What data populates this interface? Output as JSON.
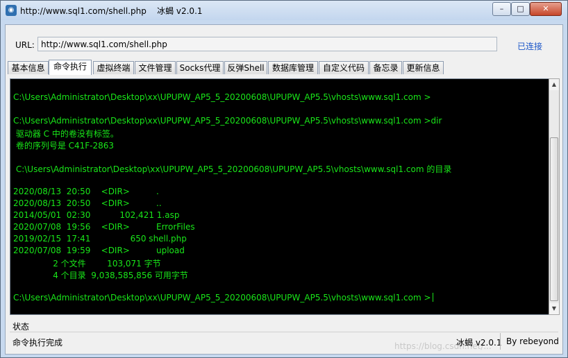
{
  "window": {
    "title": "http://www.sql1.com/shell.php    冰蝎 v2.0.1",
    "buttons": {
      "minimize": "–",
      "maximize": "□",
      "close": "✕"
    }
  },
  "url_bar": {
    "label": "URL:",
    "value": "http://www.sql1.com/shell.php",
    "status": "已连接"
  },
  "tabs": [
    {
      "label": "基本信息"
    },
    {
      "label": "命令执行",
      "active": true
    },
    {
      "label": "虚拟终端"
    },
    {
      "label": "文件管理"
    },
    {
      "label": "Socks代理"
    },
    {
      "label": "反弹Shell"
    },
    {
      "label": "数据库管理"
    },
    {
      "label": "自定义代码"
    },
    {
      "label": "备忘录"
    },
    {
      "label": "更新信息"
    }
  ],
  "console": {
    "lines": [
      "C:\\Users\\Administrator\\Desktop\\xx\\UPUPW_AP5_5_20200608\\UPUPW_AP5.5\\vhosts\\www.sql1.com >",
      "C:\\Users\\Administrator\\Desktop\\xx\\UPUPW_AP5_5_20200608\\UPUPW_AP5.5\\vhosts\\www.sql1.com >dir",
      " 驱动器 C 中的卷没有标签。",
      " 卷的序列号是 C41F-2863",
      " C:\\Users\\Administrator\\Desktop\\xx\\UPUPW_AP5_5_20200608\\UPUPW_AP5.5\\vhosts\\www.sql1.com 的目录",
      "2020/08/13  20:50    <DIR>          .",
      "2020/08/13  20:50    <DIR>          ..",
      "2014/05/01  02:30           102,421 1.asp",
      "2020/07/08  19:56    <DIR>          ErrorFiles",
      "2019/02/15  17:41               650 shell.php",
      "2020/07/08  19:59    <DIR>          upload",
      "               2 个文件        103,071 字节",
      "               4 个目录  9,038,585,856 可用字节",
      "C:\\Users\\Administrator\\Desktop\\xx\\UPUPW_AP5_5_20200608\\UPUPW_AP5.5\\vhosts\\www.sql1.com >"
    ]
  },
  "scrollbar": {
    "up": "▲",
    "down": "▼"
  },
  "status_bar": {
    "label": "状态",
    "message": "命令执行完成",
    "app": "冰蝎 v2.0.1",
    "author": "By rebeyond"
  },
  "watermark": "https://blog.csdn.net/..."
}
